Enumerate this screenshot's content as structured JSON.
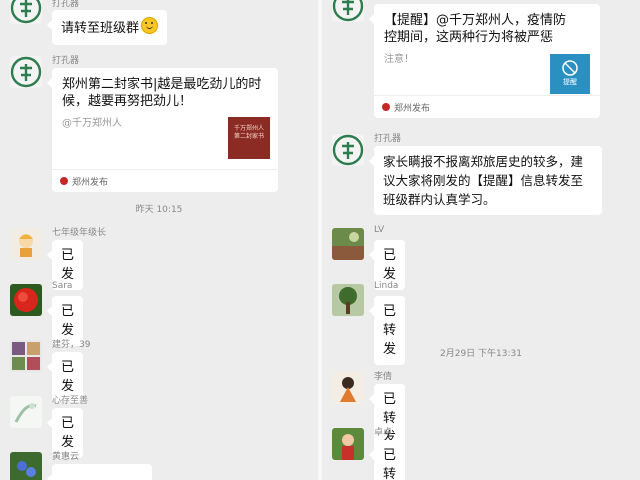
{
  "left": {
    "msg1": {
      "sender": "打孔器",
      "text": "请转至班级群"
    },
    "msg2": {
      "sender": "打孔器",
      "title": "郑州第二封家书|越是最吃劲儿的时候，越要再努把劲儿！",
      "desc": "@千万郑州人",
      "thumb_text": "千万郑州人 第二封家书",
      "source": "郑州发布"
    },
    "timestamp": "昨天 10:15",
    "replies": [
      {
        "sender": "七年级年级长",
        "text": "已发",
        "avatar": "cartoon-avatar"
      },
      {
        "sender": "Sara",
        "text": "已发",
        "avatar": "red-flower-avatar"
      },
      {
        "sender": "建芬，39",
        "text": "已发",
        "avatar": "collage-avatar"
      },
      {
        "sender": "心存至善",
        "text": "已发",
        "avatar": "light-avatar"
      },
      {
        "sender": "黄惠云",
        "text": "",
        "avatar": "blue-flower-avatar"
      }
    ]
  },
  "right": {
    "card": {
      "title": "【提醒】@千万郑州人，疫情防控期间，这两种行为将被严惩",
      "desc": "注意！",
      "thumb_text": "提醒",
      "source": "郑州发布"
    },
    "msg2": {
      "sender": "打孔器",
      "text": "家长瞒报不报离郑旅居史的较多，建议大家将刚发的【提醒】信息转发至班级群内认真学习。"
    },
    "replies": [
      {
        "sender": "LV",
        "text": "已发",
        "avatar": "landscape-avatar"
      },
      {
        "sender": "Linda",
        "text": "已转发",
        "avatar": "tree-avatar"
      }
    ],
    "timestamp": "2月29日 下午13:31",
    "replies2": [
      {
        "sender": "李倩",
        "text": "已转发",
        "avatar": "girl-avatar"
      },
      {
        "sender": "卓卓",
        "text": "已转",
        "avatar": "photo-avatar"
      }
    ]
  },
  "colors": {
    "background": "#ededed",
    "bubble": "#ffffff",
    "avatar_green": "#2e7d4f",
    "source_red": "#c62828"
  }
}
